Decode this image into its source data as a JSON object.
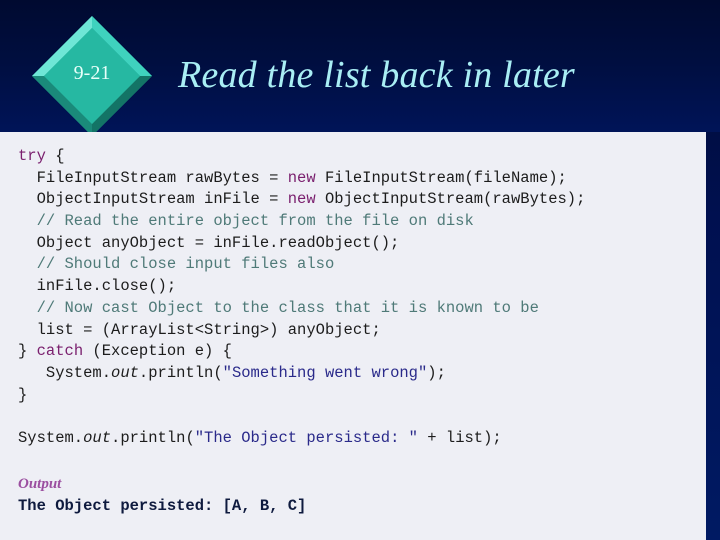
{
  "slide": {
    "number": "9-21",
    "title": "Read the list back in later"
  },
  "colors": {
    "background": "#001050",
    "panel": "#eeeff5",
    "title": "#a9eef4",
    "diamond": "#26b8a2",
    "keyword": "#7a1f6e",
    "comment": "#4f7a78",
    "string": "#2a2a8a",
    "output_label": "#9b4fa0"
  },
  "code": {
    "l1": {
      "kw": "try",
      "rest": " {"
    },
    "l2": {
      "a": "  FileInputStream rawBytes = ",
      "kw": "new",
      "b": " FileInputStream(fileName);"
    },
    "l3": {
      "a": "  ObjectInputStream inFile = ",
      "kw": "new",
      "b": " ObjectInputStream(rawBytes);"
    },
    "l4": {
      "cm": "  // Read the entire object from the file on disk"
    },
    "l5": {
      "a": "  Object anyObject = inFile.readObject();"
    },
    "l6": {
      "cm": "  // Should close input files also"
    },
    "l7": {
      "a": "  inFile.close();"
    },
    "l8": {
      "cm": "  // Now cast Object to the class that it is known to be"
    },
    "l9": {
      "a": "  list = (ArrayList<String>) anyObject;"
    },
    "l10": {
      "a": "} ",
      "kw": "catch",
      "b": " (Exception e) {"
    },
    "l11": {
      "a": "   System.",
      "it": "out",
      "b": ".println(",
      "st": "\"Something went wrong\"",
      "c": ");"
    },
    "l12": {
      "a": "}"
    },
    "l13": {
      "a": "System.",
      "it": "out",
      "b": ".println(",
      "st": "\"The Object persisted: \"",
      "c": " + list);"
    }
  },
  "output": {
    "label": "Output",
    "text": "The Object persisted: [A, B, C]"
  }
}
